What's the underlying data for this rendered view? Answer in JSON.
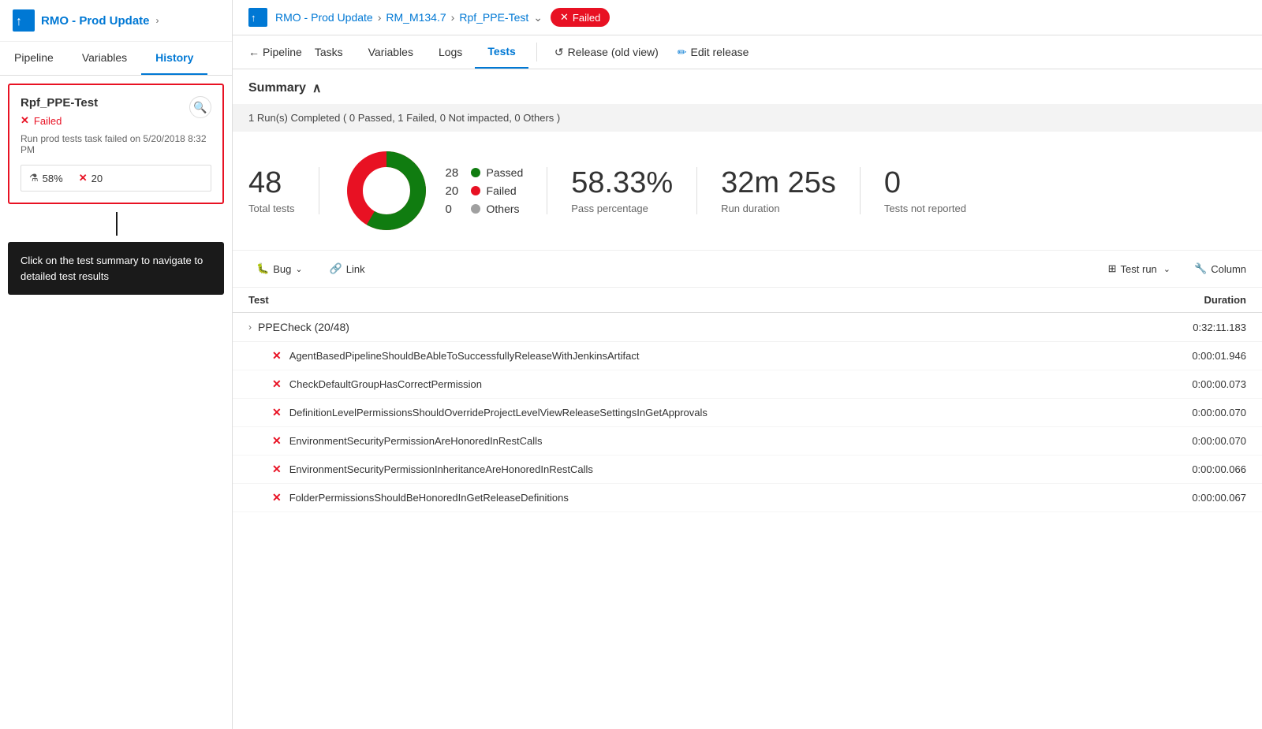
{
  "sidebar": {
    "logo": "↑",
    "title": "RMO - Prod Update",
    "tabs": [
      {
        "label": "Pipeline",
        "active": false
      },
      {
        "label": "Variables",
        "active": false
      },
      {
        "label": "History",
        "active": true
      }
    ],
    "card": {
      "title": "Rpf_PPE-Test",
      "status": "Failed",
      "info": "Run prod tests task failed on 5/20/2018 8:32 PM",
      "pass_pct": "58%",
      "fail_count": "20"
    },
    "tooltip": "Click on the test summary to navigate to detailed test results"
  },
  "header": {
    "breadcrumb": [
      {
        "label": "RMO - Prod Update"
      },
      {
        "label": "RM_M134.7"
      },
      {
        "label": "Rpf_PPE-Test"
      }
    ],
    "status": "Failed",
    "nav_tabs": [
      {
        "label": "Pipeline",
        "active": false
      },
      {
        "label": "Tasks",
        "active": false
      },
      {
        "label": "Variables",
        "active": false
      },
      {
        "label": "Logs",
        "active": false
      },
      {
        "label": "Tests",
        "active": true
      }
    ],
    "actions": [
      {
        "label": "Release (old view)"
      },
      {
        "label": "Edit release"
      }
    ],
    "back_label": "Pipeline"
  },
  "summary": {
    "title": "Summary",
    "run_completed": "1 Run(s) Completed ( 0 Passed, 1 Failed, 0 Not impacted, 0 Others )",
    "total_tests": "48",
    "total_label": "Total tests",
    "passed": 28,
    "failed": 20,
    "others": 0,
    "pass_pct": "58.33%",
    "pass_pct_label": "Pass percentage",
    "run_duration": "32m 25s",
    "run_duration_label": "Run duration",
    "not_reported": "0",
    "not_reported_label": "Tests not reported"
  },
  "toolbar": {
    "bug_label": "Bug",
    "link_label": "Link",
    "test_run_label": "Test run",
    "column_label": "Column"
  },
  "table": {
    "col_test": "Test",
    "col_duration": "Duration",
    "groups": [
      {
        "name": "PPECheck (20/48)",
        "duration": "0:32:11.183",
        "rows": [
          {
            "name": "AgentBasedPipelineShouldBeAbleToSuccessfullyReleaseWithJenkinsArtifact",
            "duration": "0:00:01.946"
          },
          {
            "name": "CheckDefaultGroupHasCorrectPermission",
            "duration": "0:00:00.073"
          },
          {
            "name": "DefinitionLevelPermissionsShouldOverrideProjectLevelViewReleaseSettingsInGetApprovals",
            "duration": "0:00:00.070"
          },
          {
            "name": "EnvironmentSecurityPermissionAreHonoredInRestCalls",
            "duration": "0:00:00.070"
          },
          {
            "name": "EnvironmentSecurityPermissionInheritanceAreHonoredInRestCalls",
            "duration": "0:00:00.066"
          },
          {
            "name": "FolderPermissionsShouldBeHonoredInGetReleaseDefinitions",
            "duration": "0:00:00.067"
          }
        ]
      }
    ]
  },
  "colors": {
    "passed": "#107c10",
    "failed": "#e81123",
    "others": "#a0a0a0",
    "accent": "#0078d4"
  }
}
